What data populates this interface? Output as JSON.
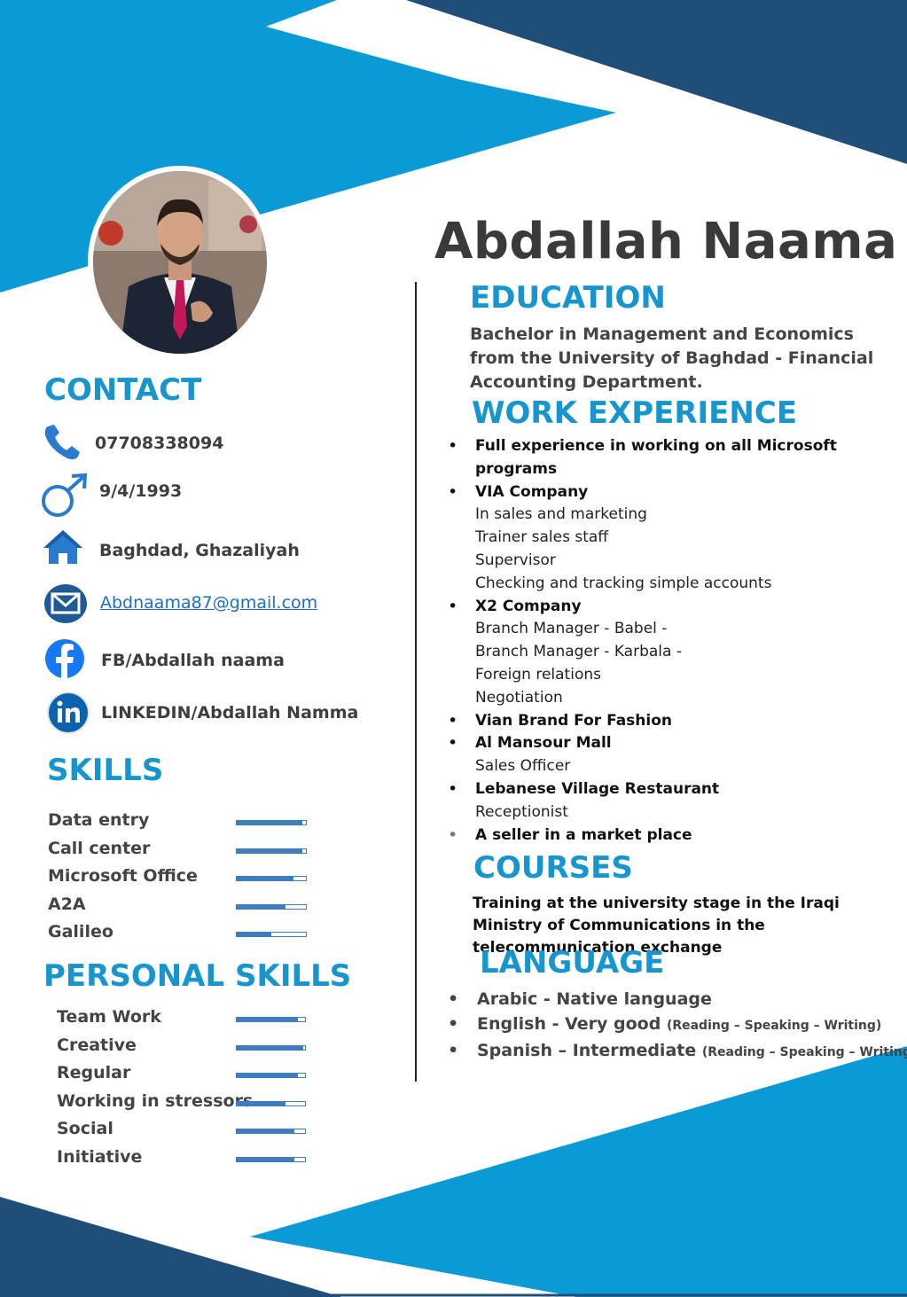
{
  "name": "Abdallah Naama",
  "contact": {
    "heading": "CONTACT",
    "phone": "07708338094",
    "birthdate": "9/4/1993",
    "address": "Baghdad, Ghazaliyah",
    "email": "Abdnaama87@gmail.com",
    "facebook": "FB/Abdallah naama",
    "linkedin": "LINKEDIN/Abdallah Namma",
    "icons": [
      "phone-icon",
      "male-symbol-icon",
      "home-icon",
      "email-icon",
      "facebook-icon",
      "linkedin-icon"
    ]
  },
  "skills": {
    "heading": "SKILLS",
    "items": [
      {
        "label": "Data entry",
        "level": 0.95
      },
      {
        "label": "Call center",
        "level": 0.95
      },
      {
        "label": "Microsoft Office",
        "level": 0.82
      },
      {
        "label": "A2A",
        "level": 0.7
      },
      {
        "label": "Galileo",
        "level": 0.5
      }
    ]
  },
  "personal_skills": {
    "heading": "PERSONAL SKILLS",
    "items": [
      {
        "label": "Team Work",
        "level": 0.9
      },
      {
        "label": "Creative",
        "level": 0.97
      },
      {
        "label": "Regular",
        "level": 0.9
      },
      {
        "label": "Working in stressors",
        "level": 0.72
      },
      {
        "label": "Social",
        "level": 0.84
      },
      {
        "label": "Initiative",
        "level": 0.84
      }
    ]
  },
  "education": {
    "heading": "EDUCATION",
    "text": "Bachelor in Management and Economics from the University of Baghdad - Financial Accounting Department."
  },
  "work": {
    "heading": "WORK EXPERIENCE",
    "items": [
      {
        "title": "Full experience in working on all Microsoft programs",
        "subs": []
      },
      {
        "title": "VIA  Company",
        "subs": [
          "In sales and marketing",
          "Trainer sales staff",
          "Supervisor",
          "Checking and tracking simple accounts"
        ]
      },
      {
        "title": "X2 Company",
        "subs": [
          "Branch Manager - Babel -",
          "Branch Manager - Karbala -",
          "Foreign relations",
          "Negotiation"
        ]
      },
      {
        "title": "Vian Brand For Fashion",
        "subs": []
      },
      {
        "title": "Al Mansour Mall",
        "subs": [
          "Sales Officer"
        ]
      },
      {
        "title": "Lebanese Village Restaurant",
        "subs": [
          "Receptionist"
        ]
      },
      {
        "title": "A seller in a market place",
        "subs": []
      }
    ]
  },
  "courses": {
    "heading": "COURSES",
    "text": "Training at the university stage in the Iraqi Ministry of Communications in the telecommunication exchange"
  },
  "language": {
    "heading": "LANGUAGE",
    "items": [
      {
        "main": "Arabic - Native language",
        "note": ""
      },
      {
        "main": "English - Very good ",
        "note": "(Reading – Speaking – Writing)"
      },
      {
        "main": "Spanish – Intermediate ",
        "note": "(Reading – Speaking – Writing)"
      }
    ]
  },
  "colors": {
    "accent": "#1795cf",
    "dark_blue": "#1f4e79",
    "light_blue": "#0a9ad6",
    "bar": "#3d7dc0"
  }
}
